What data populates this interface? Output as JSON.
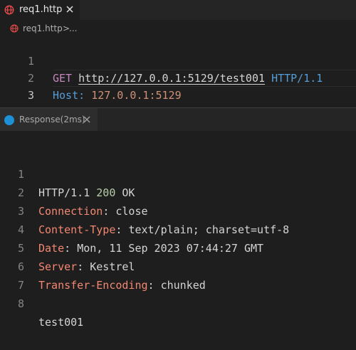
{
  "editor_tab": {
    "title": "req1.http",
    "icon": "globe-icon",
    "icon_color": "#f14c4c"
  },
  "breadcrumb": {
    "file": "req1.http",
    "separator": ">",
    "more": "..."
  },
  "request": {
    "lines": [
      {
        "number": "1",
        "method": "GET",
        "url": "http://127.0.0.1:5129/test001",
        "version": "HTTP/1.1"
      },
      {
        "number": "2",
        "header_name": "Host:",
        "header_value": "127.0.0.1:5129"
      },
      {
        "number": "3"
      }
    ]
  },
  "response_tab": {
    "title": "Response(2ms)",
    "icon_color": "#1e90d6"
  },
  "response": {
    "lines": [
      {
        "number": "1",
        "version": "HTTP/1.1",
        "status_code": "200",
        "status_text": "OK"
      },
      {
        "number": "2",
        "key": "Connection",
        "value": "close"
      },
      {
        "number": "3",
        "key": "Content-Type",
        "value": "text/plain; charset=utf-8"
      },
      {
        "number": "4",
        "key": "Date",
        "value": "Mon, 11 Sep 2023 07:44:27 GMT"
      },
      {
        "number": "5",
        "key": "Server",
        "value": "Kestrel"
      },
      {
        "number": "6",
        "key": "Transfer-Encoding",
        "value": "chunked"
      },
      {
        "number": "7"
      },
      {
        "number": "8",
        "body": "test001"
      }
    ]
  }
}
